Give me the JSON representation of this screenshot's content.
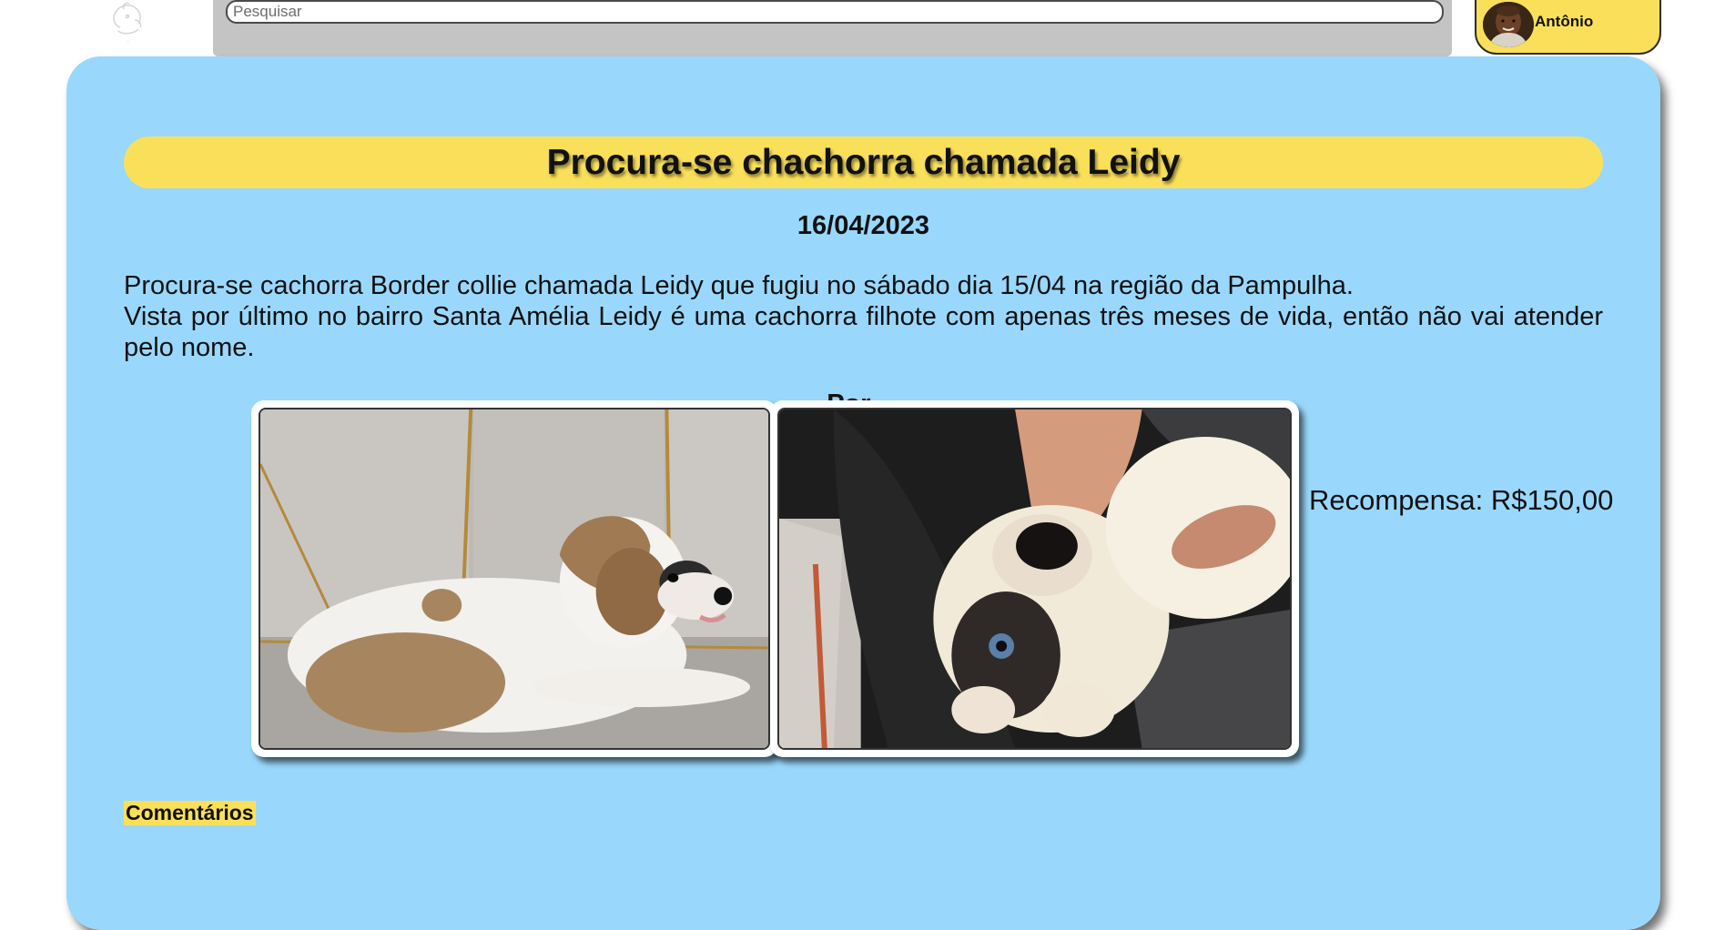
{
  "header": {
    "logo_icon": "paw-dog-logo-icon",
    "search": {
      "placeholder": "Pesquisar",
      "value": ""
    },
    "user": {
      "name": "Antônio",
      "avatar_icon": "user-avatar-icon"
    }
  },
  "post": {
    "title": "Procura-se chachorra chamada Leidy",
    "date": "16/04/2023",
    "description": [
      "Procura-se cachorra Border collie chamada Leidy que fugiu no sábado dia 15/04 na região da Pampulha.",
      "Vista por último no bairro Santa Amélia Leidy é uma cachorra filhote com apenas três meses de vida, então não vai atender pelo nome."
    ],
    "hidden_caption": "Por ...",
    "photos": [
      "puppy-lying-photo",
      "puppy-held-photo"
    ],
    "reward": "Recompensa: R$150,00"
  },
  "comments": {
    "label": "Comentários"
  },
  "colors": {
    "card_bg": "#99d8fc",
    "accent_yellow": "#fae05a",
    "search_bar_bg": "#c4c4c4"
  }
}
